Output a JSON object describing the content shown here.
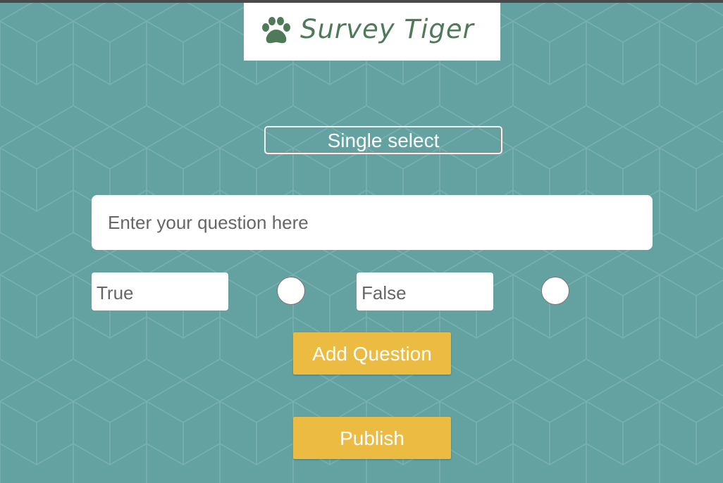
{
  "header": {
    "logo_text": "Survey Tiger",
    "logo_icon": "paw-icon"
  },
  "form": {
    "question_type": "Single select",
    "question_placeholder": "Enter your question here",
    "options": [
      {
        "value": "True",
        "selected": false
      },
      {
        "value": "False",
        "selected": false
      }
    ],
    "add_question_label": "Add Question",
    "publish_label": "Publish"
  },
  "colors": {
    "background": "#64a2a2",
    "logo_green": "#4f7a5a",
    "button_yellow": "#ebbb42"
  }
}
